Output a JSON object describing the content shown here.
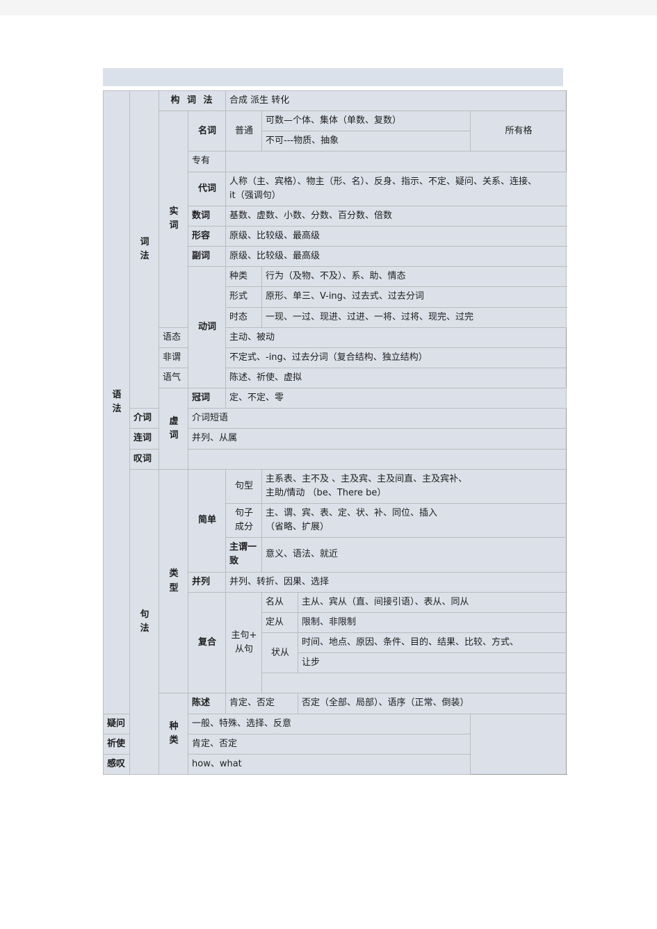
{
  "document": {
    "title_char_1": "语",
    "title_char_2": "法",
    "colors": {
      "cell_bg": "#dce1e9",
      "page_bg": "#ffffff",
      "border": "#b9bcbf",
      "top_strip": "#f5f5f5"
    }
  },
  "root": {
    "label_lines": [
      "语",
      "法"
    ]
  },
  "sections": {
    "morphology": {
      "label_lines": [
        "词",
        "法"
      ],
      "word_formation": {
        "label": "构 词 法",
        "value": "合成 派生 转化"
      },
      "content_words": {
        "label_lines": [
          "实",
          "词"
        ],
        "noun": {
          "label": "名词",
          "common_label": "普通",
          "countable": "可数—个体、集体（单数、复数）",
          "uncountable": "不可---物质、抽象",
          "possessive": "所有格",
          "proper_label": "专有",
          "proper_value": ""
        },
        "pronoun": {
          "label": "代词",
          "value_line1": "人称（主、宾格）、物主（形、名）、反身、指示、不定、疑问、关系、连接、",
          "value_line2": "it（强调句）"
        },
        "numeral": {
          "label": "数词",
          "value": "基数、虚数、小数、分数、百分数、倍数"
        },
        "adjective": {
          "label": "形容",
          "value": "原级、比较级、最高级"
        },
        "adverb": {
          "label": "副词",
          "value": "原级、比较级、最高级"
        },
        "verb": {
          "label": "动词",
          "rows": [
            {
              "label": "种类",
              "value": "行为（及物、不及）、系、助、情态"
            },
            {
              "label": "形式",
              "value": "原形、单三、V-ing、过去式、过去分词"
            },
            {
              "label": "时态",
              "value": "一现、一过、现进、过进、一将、过将、现完、过完"
            },
            {
              "label": "语态",
              "value": "主动、被动"
            },
            {
              "label": "非谓",
              "value": "不定式、-ing、过去分词（复合结构、独立结构）"
            },
            {
              "label": "语气",
              "value": "陈述、祈使、虚拟"
            }
          ]
        }
      },
      "function_words": {
        "label_lines": [
          "虚",
          "词"
        ],
        "rows": [
          {
            "label": "冠词",
            "value": "定、不定、零"
          },
          {
            "label": "介词",
            "value": "介词短语"
          },
          {
            "label": "连词",
            "value": "并列、从属"
          },
          {
            "label": "叹词",
            "value": ""
          }
        ]
      }
    },
    "syntax": {
      "label_lines": [
        "句",
        "法"
      ],
      "sentence_type": {
        "label_lines": [
          "类",
          "型"
        ],
        "simple": {
          "label": "简单",
          "pattern": {
            "label": "句型",
            "line1": "主系表、主不及 、主及宾、主及间直、主及宾补、",
            "line2": "主助/情动   （be、There be）"
          },
          "components": {
            "label_line1": "句子",
            "label_line2": "成分",
            "line1": "主、谓、宾、表、定、状、补、同位、插入",
            "line2": "（省略、扩展）"
          },
          "agreement": {
            "label": "主谓一致",
            "value": "意义、语法、就近"
          }
        },
        "compound": {
          "label": "并列",
          "value": "并列、转折、因果、选择"
        },
        "complex": {
          "label": "复合",
          "clause_label_line1": "主句+",
          "clause_label_line2": "从句",
          "rows": [
            {
              "label": "名从",
              "value": "主从、宾从（直、间接引语）、表从、同从"
            },
            {
              "label": "定从",
              "value": "限制、非限制"
            },
            {
              "label": "状从",
              "value_line1": "时间、地点、原因、条件、目的、结果、比较、方式、",
              "value_line2": "让步"
            }
          ]
        }
      },
      "sentence_kind": {
        "label_lines": [
          "种",
          "类"
        ],
        "rows": [
          {
            "label": "陈述",
            "value": "肯定、否定",
            "extra": "否定（全部、局部）、语序（正常、倒装）"
          },
          {
            "label": "疑问",
            "value": "一般、特殊、选择、反意",
            "extra": null
          },
          {
            "label": "祈使",
            "value": "肯定、否定",
            "extra": null
          },
          {
            "label": "感叹",
            "value": "how、what",
            "extra": null
          }
        ]
      }
    }
  }
}
